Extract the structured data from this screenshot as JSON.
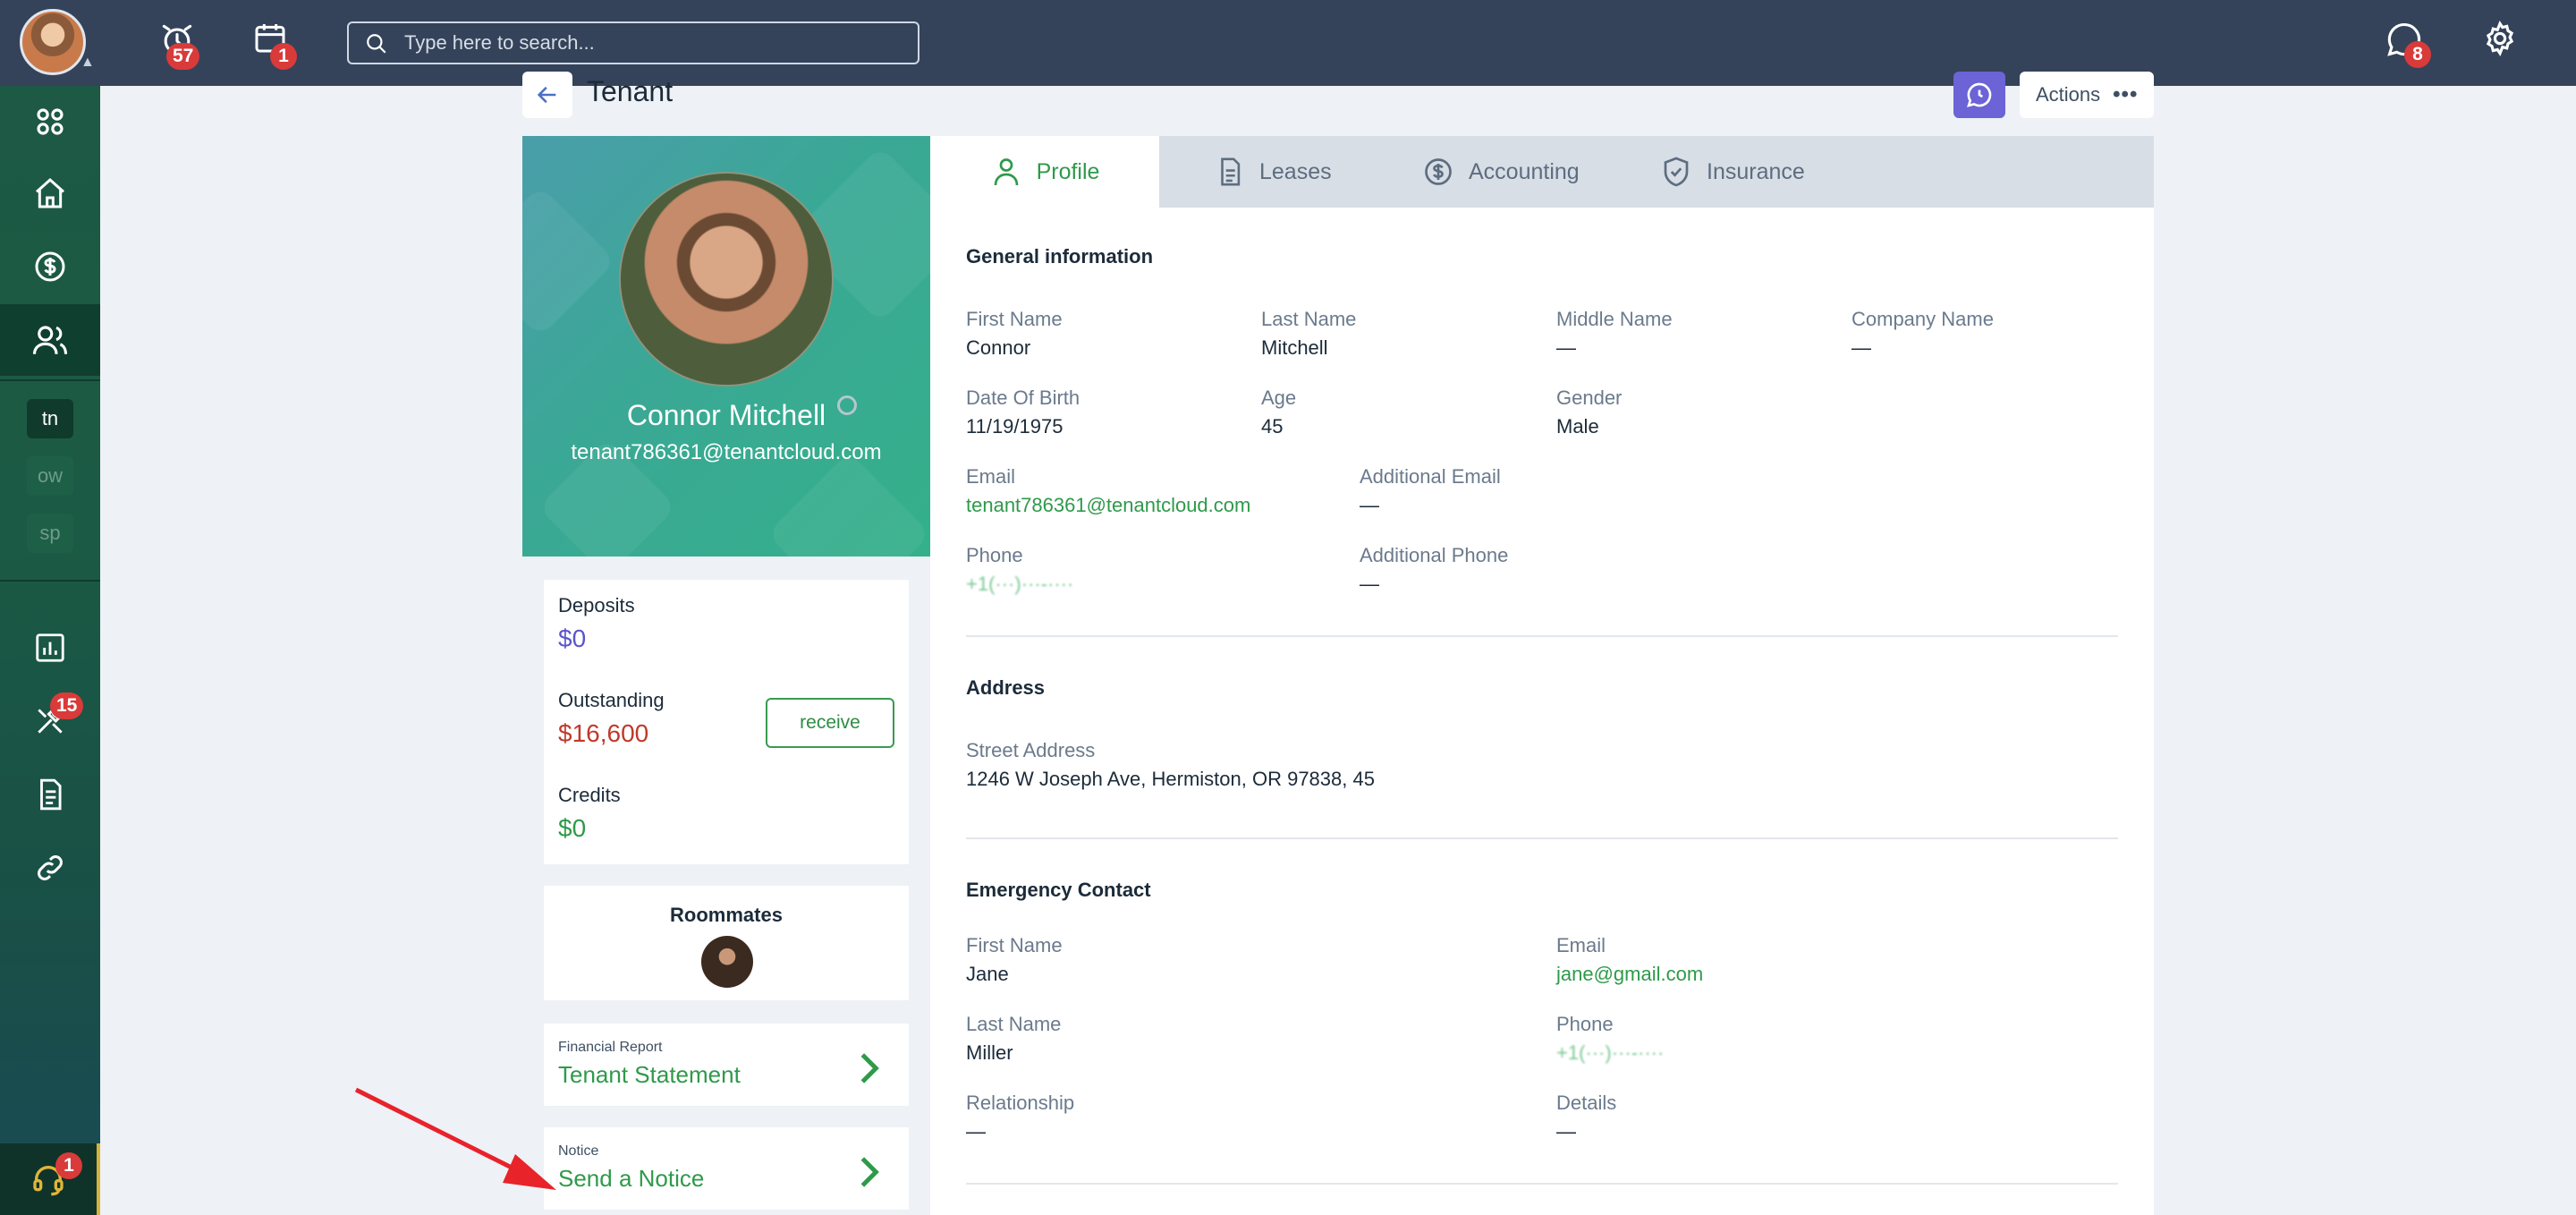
{
  "topbar": {
    "notifications_count": "57",
    "calendar_count": "1",
    "search_placeholder": "Type here to search...",
    "messages_count": "8"
  },
  "sidebar": {
    "items": [
      {
        "name": "apps",
        "icon": "apps-grid-icon"
      },
      {
        "name": "home",
        "icon": "home-icon"
      },
      {
        "name": "payments",
        "icon": "dollar-circle-icon"
      },
      {
        "name": "contacts",
        "icon": "users-icon",
        "active": true
      },
      {
        "name": "reports",
        "icon": "bar-chart-icon"
      },
      {
        "name": "maintenance",
        "icon": "tools-icon"
      },
      {
        "name": "documents",
        "icon": "document-icon"
      },
      {
        "name": "links",
        "icon": "link-icon"
      }
    ],
    "tags": [
      "tn",
      "ow",
      "sp"
    ],
    "maintenance_count": "15",
    "support_count": "1"
  },
  "header": {
    "title": "Tenant",
    "actions_label": "Actions"
  },
  "tenant": {
    "name": "Connor Mitchell",
    "email": "tenant786361@tenantcloud.com"
  },
  "finance": {
    "deposits_label": "Deposits",
    "deposits_value": "$0",
    "outstanding_label": "Outstanding",
    "outstanding_value": "$16,600",
    "receive_label": "receive",
    "credits_label": "Credits",
    "credits_value": "$0"
  },
  "roommates": {
    "title": "Roommates"
  },
  "links": {
    "financial_small": "Financial Report",
    "financial_big": "Tenant Statement",
    "notice_small": "Notice",
    "notice_big": "Send a Notice"
  },
  "tabs": [
    {
      "label": "Profile",
      "icon": "user-icon",
      "active": true
    },
    {
      "label": "Leases",
      "icon": "document-icon"
    },
    {
      "label": "Accounting",
      "icon": "dollar-circle-icon"
    },
    {
      "label": "Insurance",
      "icon": "shield-check-icon"
    }
  ],
  "general": {
    "title": "General information",
    "first_name_label": "First Name",
    "first_name": "Connor",
    "last_name_label": "Last Name",
    "last_name": "Mitchell",
    "middle_name_label": "Middle Name",
    "middle_name": "—",
    "company_label": "Company Name",
    "company": "—",
    "dob_label": "Date Of Birth",
    "dob": "11/19/1975",
    "age_label": "Age",
    "age": "45",
    "gender_label": "Gender",
    "gender": "Male",
    "email_label": "Email",
    "email": "tenant786361@tenantcloud.com",
    "add_email_label": "Additional Email",
    "add_email": "—",
    "phone_label": "Phone",
    "phone": "+1(···)···-····",
    "add_phone_label": "Additional Phone",
    "add_phone": "—"
  },
  "address": {
    "title": "Address",
    "street_label": "Street Address",
    "street": "1246 W Joseph Ave, Hermiston, OR 97838, 45"
  },
  "emergency": {
    "title": "Emergency Contact",
    "first_name_label": "First Name",
    "first_name": "Jane",
    "email_label": "Email",
    "email": "jane@gmail.com",
    "last_name_label": "Last Name",
    "last_name": "Miller",
    "phone_label": "Phone",
    "phone": "+1(···)···-····",
    "relationship_label": "Relationship",
    "relationship": "—",
    "details_label": "Details",
    "details": "—"
  },
  "colors": {
    "topbar": "#34435a",
    "sidebar": "#1d5944",
    "accent_green": "#2e9a4a",
    "outstanding_red": "#c0392b",
    "deposit_purple": "#5b55c9",
    "badge_red": "#d93a3a",
    "annotation_arrow": "#e8232a"
  }
}
